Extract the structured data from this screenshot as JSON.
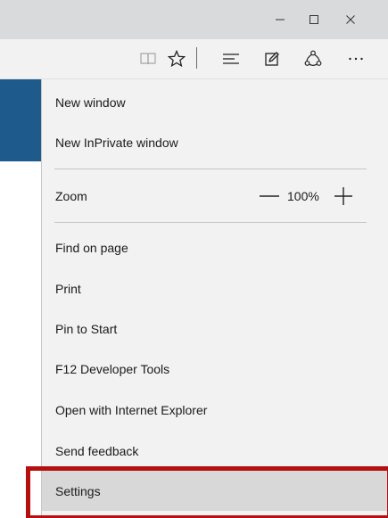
{
  "window_controls": {
    "minimize_icon": "minimize-icon",
    "maximize_icon": "maximize-icon",
    "close_icon": "close-icon"
  },
  "toolbar": {
    "icons": [
      "reading-view-icon",
      "favorite-star-icon",
      "hub-icon",
      "web-note-icon",
      "share-icon",
      "more-actions-icon"
    ]
  },
  "menu": {
    "new_window": "New window",
    "new_inprivate": "New InPrivate window",
    "zoom_label": "Zoom",
    "zoom_value": "100%",
    "find_on_page": "Find on page",
    "print": "Print",
    "pin_to_start": "Pin to Start",
    "dev_tools": "F12 Developer Tools",
    "open_with_ie": "Open with Internet Explorer",
    "send_feedback": "Send feedback",
    "settings": "Settings",
    "selected": "Settings"
  },
  "colors": {
    "titlebar": "#d9dadc",
    "menu_bg": "#f2f2f2",
    "selected_bg": "#d8d8d8",
    "highlight": "#b50f0f",
    "page_accent": "#1f5a8c"
  }
}
